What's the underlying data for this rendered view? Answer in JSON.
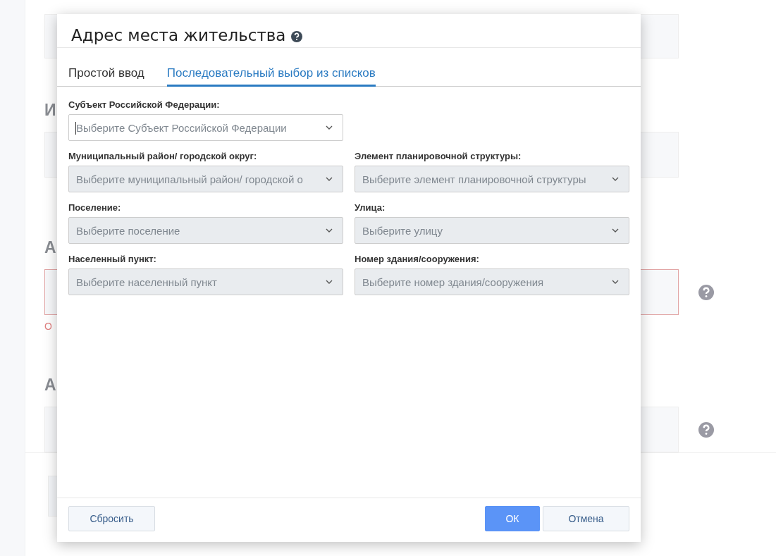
{
  "background": {
    "sections": [
      {
        "heading": "И",
        "error": false,
        "help": false
      },
      {
        "heading": "А",
        "error": true,
        "help": true,
        "error_text": "О"
      },
      {
        "heading": "А",
        "error": false,
        "help": true
      }
    ]
  },
  "dialog": {
    "title": "Адрес места жительства",
    "tabs": [
      {
        "label": "Простой ввод",
        "selected": false
      },
      {
        "label": "Последовательный выбор из списков",
        "selected": true
      }
    ],
    "rows": [
      [
        {
          "label": "Субъект Российской Федерации:",
          "placeholder": "Выберите Субъект Российской Федерации",
          "disabled": false,
          "focused": true
        }
      ],
      [
        {
          "label": "Муниципальный район/ городской округ:",
          "placeholder": "Выберите муниципальный район/ городской о",
          "disabled": true,
          "focused": false
        },
        {
          "label": "Элемент планировочной структуры:",
          "placeholder": "Выберите элемент планировочной структуры",
          "disabled": true,
          "focused": false
        }
      ],
      [
        {
          "label": "Поселение:",
          "placeholder": "Выберите поселение",
          "disabled": true,
          "focused": false
        },
        {
          "label": "Улица:",
          "placeholder": "Выберите улицу",
          "disabled": true,
          "focused": false
        }
      ],
      [
        {
          "label": "Населенный пункт:",
          "placeholder": "Выберите населенный пункт",
          "disabled": true,
          "focused": false
        },
        {
          "label": "Номер здания/сооружения:",
          "placeholder": "Выберите номер здания/сооружения",
          "disabled": true,
          "focused": false
        }
      ]
    ],
    "buttons": [
      {
        "label": "Сбросить",
        "kind": "secondary"
      },
      {
        "label": "ОК",
        "kind": "primary"
      },
      {
        "label": "Отмена",
        "kind": "secondary"
      }
    ]
  }
}
